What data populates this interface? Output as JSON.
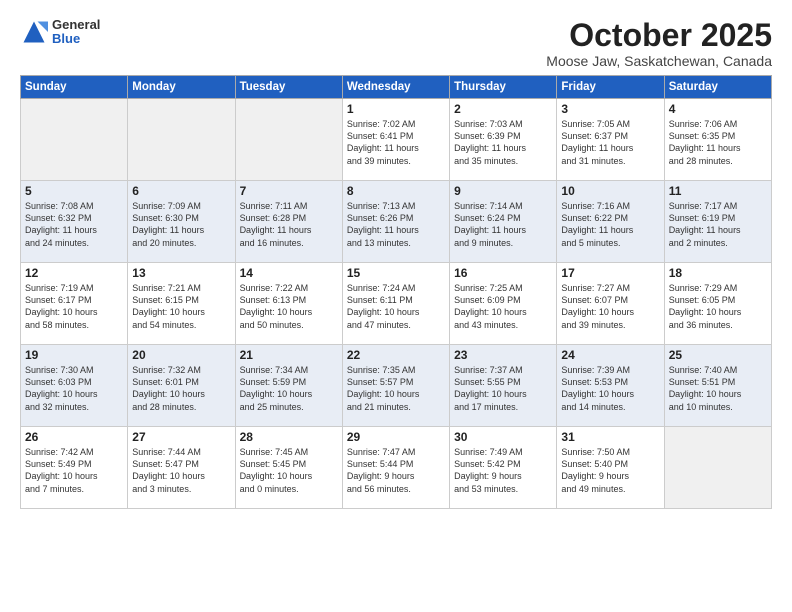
{
  "header": {
    "logo_general": "General",
    "logo_blue": "Blue",
    "month_title": "October 2025",
    "location": "Moose Jaw, Saskatchewan, Canada"
  },
  "columns": [
    "Sunday",
    "Monday",
    "Tuesday",
    "Wednesday",
    "Thursday",
    "Friday",
    "Saturday"
  ],
  "weeks": [
    [
      {
        "day": "",
        "info": ""
      },
      {
        "day": "",
        "info": ""
      },
      {
        "day": "",
        "info": ""
      },
      {
        "day": "1",
        "info": "Sunrise: 7:02 AM\nSunset: 6:41 PM\nDaylight: 11 hours\nand 39 minutes."
      },
      {
        "day": "2",
        "info": "Sunrise: 7:03 AM\nSunset: 6:39 PM\nDaylight: 11 hours\nand 35 minutes."
      },
      {
        "day": "3",
        "info": "Sunrise: 7:05 AM\nSunset: 6:37 PM\nDaylight: 11 hours\nand 31 minutes."
      },
      {
        "day": "4",
        "info": "Sunrise: 7:06 AM\nSunset: 6:35 PM\nDaylight: 11 hours\nand 28 minutes."
      }
    ],
    [
      {
        "day": "5",
        "info": "Sunrise: 7:08 AM\nSunset: 6:32 PM\nDaylight: 11 hours\nand 24 minutes."
      },
      {
        "day": "6",
        "info": "Sunrise: 7:09 AM\nSunset: 6:30 PM\nDaylight: 11 hours\nand 20 minutes."
      },
      {
        "day": "7",
        "info": "Sunrise: 7:11 AM\nSunset: 6:28 PM\nDaylight: 11 hours\nand 16 minutes."
      },
      {
        "day": "8",
        "info": "Sunrise: 7:13 AM\nSunset: 6:26 PM\nDaylight: 11 hours\nand 13 minutes."
      },
      {
        "day": "9",
        "info": "Sunrise: 7:14 AM\nSunset: 6:24 PM\nDaylight: 11 hours\nand 9 minutes."
      },
      {
        "day": "10",
        "info": "Sunrise: 7:16 AM\nSunset: 6:22 PM\nDaylight: 11 hours\nand 5 minutes."
      },
      {
        "day": "11",
        "info": "Sunrise: 7:17 AM\nSunset: 6:19 PM\nDaylight: 11 hours\nand 2 minutes."
      }
    ],
    [
      {
        "day": "12",
        "info": "Sunrise: 7:19 AM\nSunset: 6:17 PM\nDaylight: 10 hours\nand 58 minutes."
      },
      {
        "day": "13",
        "info": "Sunrise: 7:21 AM\nSunset: 6:15 PM\nDaylight: 10 hours\nand 54 minutes."
      },
      {
        "day": "14",
        "info": "Sunrise: 7:22 AM\nSunset: 6:13 PM\nDaylight: 10 hours\nand 50 minutes."
      },
      {
        "day": "15",
        "info": "Sunrise: 7:24 AM\nSunset: 6:11 PM\nDaylight: 10 hours\nand 47 minutes."
      },
      {
        "day": "16",
        "info": "Sunrise: 7:25 AM\nSunset: 6:09 PM\nDaylight: 10 hours\nand 43 minutes."
      },
      {
        "day": "17",
        "info": "Sunrise: 7:27 AM\nSunset: 6:07 PM\nDaylight: 10 hours\nand 39 minutes."
      },
      {
        "day": "18",
        "info": "Sunrise: 7:29 AM\nSunset: 6:05 PM\nDaylight: 10 hours\nand 36 minutes."
      }
    ],
    [
      {
        "day": "19",
        "info": "Sunrise: 7:30 AM\nSunset: 6:03 PM\nDaylight: 10 hours\nand 32 minutes."
      },
      {
        "day": "20",
        "info": "Sunrise: 7:32 AM\nSunset: 6:01 PM\nDaylight: 10 hours\nand 28 minutes."
      },
      {
        "day": "21",
        "info": "Sunrise: 7:34 AM\nSunset: 5:59 PM\nDaylight: 10 hours\nand 25 minutes."
      },
      {
        "day": "22",
        "info": "Sunrise: 7:35 AM\nSunset: 5:57 PM\nDaylight: 10 hours\nand 21 minutes."
      },
      {
        "day": "23",
        "info": "Sunrise: 7:37 AM\nSunset: 5:55 PM\nDaylight: 10 hours\nand 17 minutes."
      },
      {
        "day": "24",
        "info": "Sunrise: 7:39 AM\nSunset: 5:53 PM\nDaylight: 10 hours\nand 14 minutes."
      },
      {
        "day": "25",
        "info": "Sunrise: 7:40 AM\nSunset: 5:51 PM\nDaylight: 10 hours\nand 10 minutes."
      }
    ],
    [
      {
        "day": "26",
        "info": "Sunrise: 7:42 AM\nSunset: 5:49 PM\nDaylight: 10 hours\nand 7 minutes."
      },
      {
        "day": "27",
        "info": "Sunrise: 7:44 AM\nSunset: 5:47 PM\nDaylight: 10 hours\nand 3 minutes."
      },
      {
        "day": "28",
        "info": "Sunrise: 7:45 AM\nSunset: 5:45 PM\nDaylight: 10 hours\nand 0 minutes."
      },
      {
        "day": "29",
        "info": "Sunrise: 7:47 AM\nSunset: 5:44 PM\nDaylight: 9 hours\nand 56 minutes."
      },
      {
        "day": "30",
        "info": "Sunrise: 7:49 AM\nSunset: 5:42 PM\nDaylight: 9 hours\nand 53 minutes."
      },
      {
        "day": "31",
        "info": "Sunrise: 7:50 AM\nSunset: 5:40 PM\nDaylight: 9 hours\nand 49 minutes."
      },
      {
        "day": "",
        "info": ""
      }
    ]
  ]
}
